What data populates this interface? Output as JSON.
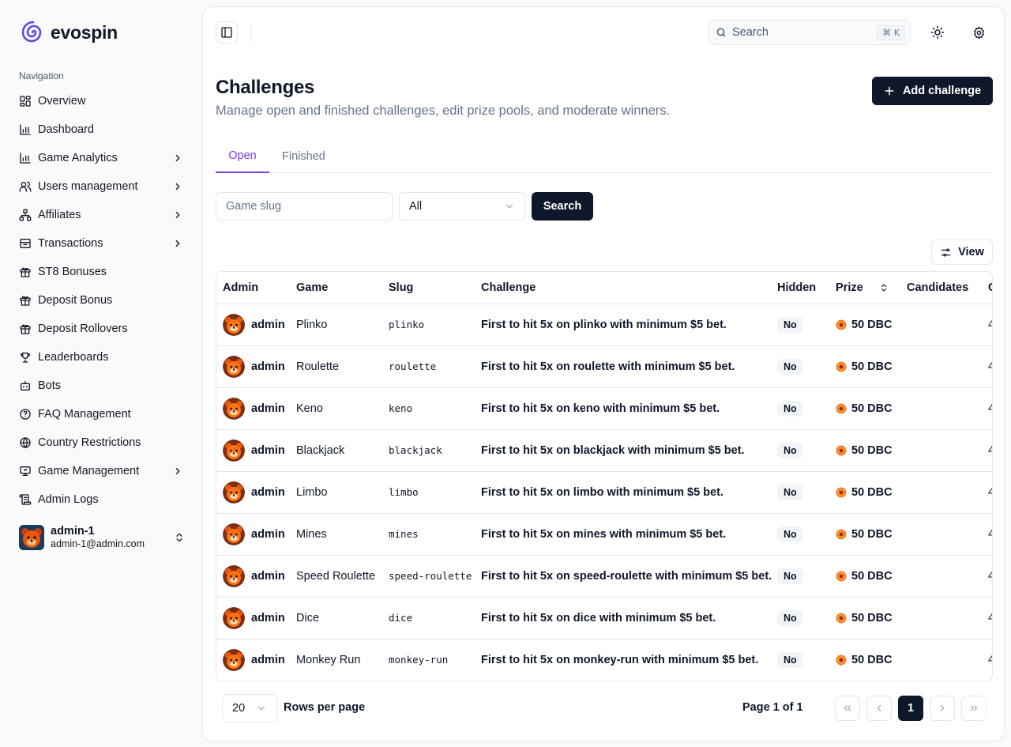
{
  "brand": {
    "name": "evospin"
  },
  "sidebar": {
    "heading": "Navigation",
    "items": [
      {
        "label": "Overview",
        "icon": "grid-icon",
        "chevron": false
      },
      {
        "label": "Dashboard",
        "icon": "bar-chart-icon",
        "chevron": false
      },
      {
        "label": "Game Analytics",
        "icon": "bar-chart-icon",
        "chevron": true
      },
      {
        "label": "Users management",
        "icon": "users-icon",
        "chevron": true
      },
      {
        "label": "Affiliates",
        "icon": "network-icon",
        "chevron": true
      },
      {
        "label": "Transactions",
        "icon": "archive-icon",
        "chevron": true
      },
      {
        "label": "ST8 Bonuses",
        "icon": "gift-icon",
        "chevron": false
      },
      {
        "label": "Deposit Bonus",
        "icon": "gift-icon",
        "chevron": false
      },
      {
        "label": "Deposit Rollovers",
        "icon": "gift-icon",
        "chevron": false
      },
      {
        "label": "Leaderboards",
        "icon": "trophy-icon",
        "chevron": false
      },
      {
        "label": "Bots",
        "icon": "bot-icon",
        "chevron": false
      },
      {
        "label": "FAQ Management",
        "icon": "help-circle-icon",
        "chevron": false
      },
      {
        "label": "Country Restrictions",
        "icon": "globe-icon",
        "chevron": false
      },
      {
        "label": "Game Management",
        "icon": "monitor-icon",
        "chevron": true
      },
      {
        "label": "Admin Logs",
        "icon": "scroll-icon",
        "chevron": false
      }
    ],
    "user": {
      "name": "admin-1",
      "email": "admin-1@admin.com"
    }
  },
  "topbar": {
    "search_placeholder": "Search",
    "shortcut": "⌘ K"
  },
  "page": {
    "title": "Challenges",
    "subtitle": "Manage open and finished challenges, edit prize pools, and moderate winners.",
    "add_button": "Add challenge"
  },
  "tabs": [
    {
      "label": "Open",
      "active": true
    },
    {
      "label": "Finished",
      "active": false
    }
  ],
  "filters": {
    "slug_placeholder": "Game slug",
    "select_value": "All",
    "search_button": "Search",
    "view_button": "View"
  },
  "table": {
    "columns": [
      "Admin",
      "Game",
      "Slug",
      "Challenge",
      "Hidden",
      "Prize",
      "Candidates",
      "C"
    ],
    "rows": [
      {
        "admin": "admin",
        "game": "Plinko",
        "slug": "plinko",
        "challenge": "First to hit 5x on plinko with minimum $5 bet.",
        "hidden": "No",
        "prize": "50 DBC",
        "date": "4/"
      },
      {
        "admin": "admin",
        "game": "Roulette",
        "slug": "roulette",
        "challenge": "First to hit 5x on roulette with minimum $5 bet.",
        "hidden": "No",
        "prize": "50 DBC",
        "date": "4/"
      },
      {
        "admin": "admin",
        "game": "Keno",
        "slug": "keno",
        "challenge": "First to hit 5x on keno with minimum $5 bet.",
        "hidden": "No",
        "prize": "50 DBC",
        "date": "4/"
      },
      {
        "admin": "admin",
        "game": "Blackjack",
        "slug": "blackjack",
        "challenge": "First to hit 5x on blackjack with minimum $5 bet.",
        "hidden": "No",
        "prize": "50 DBC",
        "date": "4/"
      },
      {
        "admin": "admin",
        "game": "Limbo",
        "slug": "limbo",
        "challenge": "First to hit 5x on limbo with minimum $5 bet.",
        "hidden": "No",
        "prize": "50 DBC",
        "date": "4/"
      },
      {
        "admin": "admin",
        "game": "Mines",
        "slug": "mines",
        "challenge": "First to hit 5x on mines with minimum $5 bet.",
        "hidden": "No",
        "prize": "50 DBC",
        "date": "4/"
      },
      {
        "admin": "admin",
        "game": "Speed Roulette",
        "slug": "speed-roulette",
        "challenge": "First to hit 5x on speed-roulette with minimum $5 bet.",
        "hidden": "No",
        "prize": "50 DBC",
        "date": "4/"
      },
      {
        "admin": "admin",
        "game": "Dice",
        "slug": "dice",
        "challenge": "First to hit 5x on dice with minimum $5 bet.",
        "hidden": "No",
        "prize": "50 DBC",
        "date": "4/"
      },
      {
        "admin": "admin",
        "game": "Monkey Run",
        "slug": "monkey-run",
        "challenge": "First to hit 5x on monkey-run with minimum $5 bet.",
        "hidden": "No",
        "prize": "50 DBC",
        "date": "4/"
      }
    ]
  },
  "pagination": {
    "rows_per_page_value": "20",
    "rows_per_page_label": "Rows per page",
    "page_label": "Page 1 of 1",
    "current_page": "1"
  },
  "colors": {
    "accent": "#7c3aed",
    "primary": "#0f172a",
    "brand": "#5b4ee6",
    "coin": "#f97316"
  }
}
